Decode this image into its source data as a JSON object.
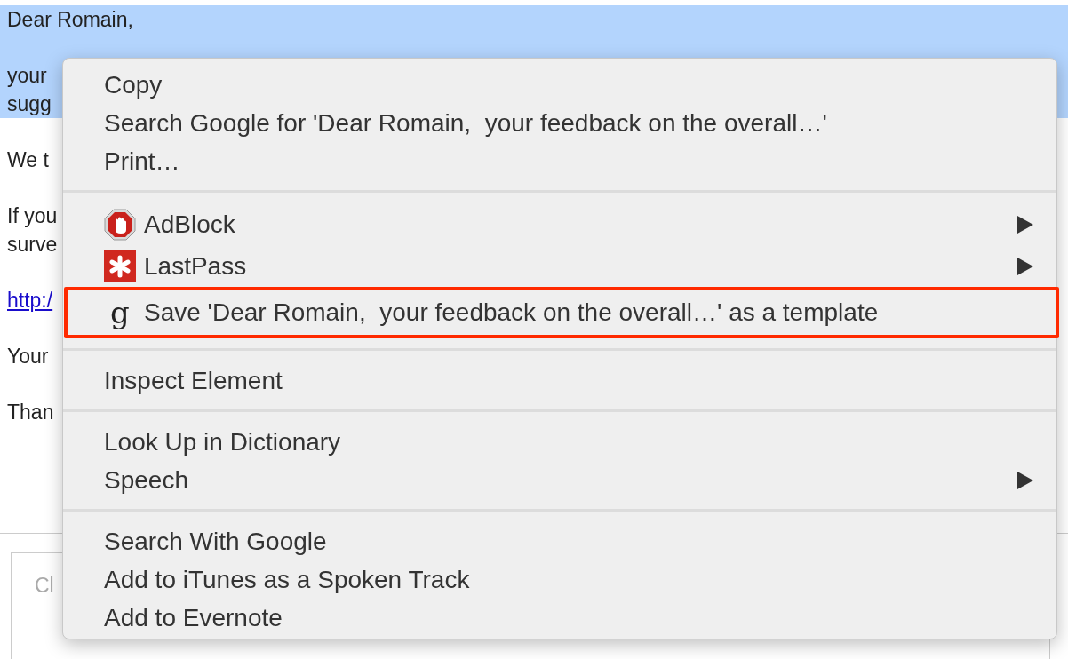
{
  "email": {
    "paragraphs": [
      {
        "lines": [
          "Dear Romain,"
        ],
        "selected": true,
        "kind": "text"
      },
      {
        "lines": [
          "your",
          "sugg"
        ],
        "selected": true,
        "kind": "text"
      },
      {
        "lines": [
          "We t"
        ],
        "selected": false,
        "kind": "text"
      },
      {
        "lines": [
          "If you",
          "surve"
        ],
        "selected": false,
        "kind": "text"
      },
      {
        "lines": [
          "http:/"
        ],
        "selected": false,
        "kind": "link"
      },
      {
        "lines": [
          "Your"
        ],
        "selected": false,
        "kind": "text"
      },
      {
        "lines": [
          "Than"
        ],
        "selected": false,
        "kind": "text"
      }
    ]
  },
  "reply": {
    "placeholder": "Cl"
  },
  "context_menu": {
    "groups": [
      {
        "items": [
          {
            "label": "Copy",
            "submenu": false,
            "annotated": false
          },
          {
            "label": "Search Google for 'Dear Romain,  your feedback on the overall…'",
            "submenu": false,
            "annotated": false
          },
          {
            "label": "Print…",
            "submenu": false,
            "annotated": false
          }
        ]
      },
      {
        "items": [
          {
            "label": "AdBlock",
            "kind": "stop-hand",
            "submenu": true,
            "annotated": false
          },
          {
            "label": "LastPass",
            "kind": "asterisk",
            "submenu": true,
            "annotated": false
          },
          {
            "label": "Save 'Dear Romain,  your feedback on the overall…' as a template",
            "kind": "glyph",
            "glyph": "g",
            "submenu": false,
            "annotated": true
          }
        ]
      },
      {
        "items": [
          {
            "label": "Inspect Element",
            "submenu": false,
            "annotated": false
          }
        ]
      },
      {
        "items": [
          {
            "label": "Look Up in Dictionary",
            "submenu": false,
            "annotated": false
          },
          {
            "label": "Speech",
            "submenu": true,
            "annotated": false
          }
        ]
      },
      {
        "items": [
          {
            "label": "Search With Google",
            "submenu": false,
            "annotated": false
          },
          {
            "label": "Add to iTunes as a Spoken Track",
            "submenu": false,
            "annotated": false
          },
          {
            "label": "Add to Evernote",
            "submenu": false,
            "annotated": false
          }
        ]
      }
    ]
  }
}
